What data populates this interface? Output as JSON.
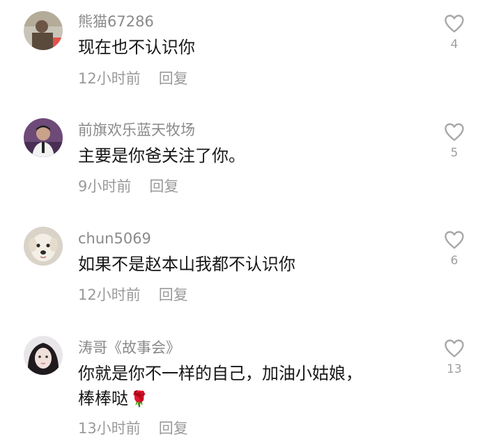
{
  "comments": [
    {
      "username": "熊猫67286",
      "text": "现在也不认识你",
      "time": "12小时前",
      "reply": "回复",
      "likes": "4",
      "avatar_icon": "person-photo-avatar"
    },
    {
      "username": "前旗欢乐蓝天牧场",
      "text": "主要是你爸关注了你。",
      "time": "9小时前",
      "reply": "回复",
      "likes": "5",
      "avatar_icon": "man-photo-avatar"
    },
    {
      "username": "chun5069",
      "text": "如果不是赵本山我都不认识你",
      "time": "12小时前",
      "reply": "回复",
      "likes": "6",
      "avatar_icon": "dog-photo-avatar"
    },
    {
      "username": "涛哥《故事会》",
      "text": "你就是你不一样的自己，加油小姑娘，",
      "text_line2": "棒棒哒",
      "emoji": "🌹",
      "time": "13小时前",
      "reply": "回复",
      "likes": "13",
      "avatar_icon": "woman-photo-avatar"
    }
  ],
  "like_icon": "heart-outline-icon",
  "colors": {
    "username": "#8a8a8a",
    "text": "#161616",
    "meta": "#9a9a9a",
    "heart": "#a8a8a8"
  }
}
